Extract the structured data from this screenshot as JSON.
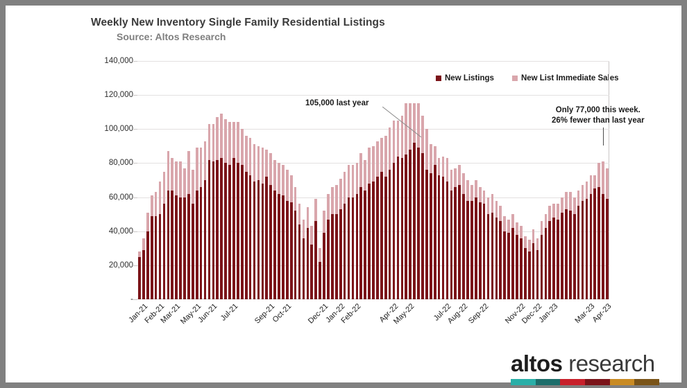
{
  "header": {
    "title": "Weekly New Inventory Single Family Residential Listings",
    "subtitle": "Source: Altos Research"
  },
  "legend": {
    "items": [
      {
        "label": "New Listings",
        "color": "#7B1419"
      },
      {
        "label": "New List Immediate Sales",
        "color": "#D9A6AC"
      }
    ]
  },
  "annotations": {
    "left": "105,000 last year",
    "right_line1": "Only 77,000 this week.",
    "right_line2": "26% fewer than last year"
  },
  "logo": {
    "primary": "altos",
    "secondary": "research",
    "bar_colors": [
      "#2AAFA8",
      "#1D6E6B",
      "#C8202B",
      "#7B1419",
      "#C98B24",
      "#7A5418"
    ]
  },
  "chart_data": {
    "type": "bar",
    "stacked": true,
    "title": "Weekly New Inventory Single Family Residential Listings",
    "subtitle": "Source: Altos Research",
    "xlabel": "",
    "ylabel": "",
    "ylim": [
      0,
      140000
    ],
    "ytick_values": [
      0,
      20000,
      40000,
      60000,
      80000,
      100000,
      120000,
      140000
    ],
    "ytick_labels": [
      "-",
      "20,000",
      "40,000",
      "60,000",
      "80,000",
      "100,000",
      "120,000",
      "140,000"
    ],
    "grid": true,
    "legend_position": "top-right",
    "xtick_labels": [
      "Jan-21",
      "Feb-21",
      "Mar-21",
      "May-21",
      "Jun-21",
      "Jul-21",
      "Sep-21",
      "Oct-21",
      "Dec-21",
      "Jan-22",
      "Feb-22",
      "Apr-22",
      "May-22",
      "Jul-22",
      "Aug-22",
      "Sep-22",
      "Nov-22",
      "Dec-22",
      "Jan-23",
      "Mar-23",
      "Apr-23"
    ],
    "xtick_indices": [
      1,
      5,
      9,
      14,
      18,
      23,
      32,
      36,
      45,
      49,
      53,
      62,
      66,
      75,
      79,
      84,
      93,
      97,
      101,
      110,
      114
    ],
    "series": [
      {
        "name": "New Listings",
        "color": "#7B1419",
        "values": [
          25000,
          29000,
          40000,
          49000,
          49000,
          50000,
          56000,
          64000,
          64000,
          61000,
          60000,
          60000,
          62000,
          56000,
          64000,
          66000,
          70000,
          82000,
          81000,
          82000,
          83000,
          80000,
          79000,
          83000,
          80000,
          79000,
          75000,
          73000,
          69000,
          70000,
          68000,
          72000,
          67000,
          64000,
          62000,
          61000,
          58000,
          57000,
          52000,
          44000,
          36000,
          42000,
          32000,
          46000,
          22000,
          39000,
          47000,
          50000,
          50000,
          53000,
          56000,
          60000,
          60000,
          62000,
          66000,
          64000,
          68000,
          69000,
          72000,
          75000,
          72000,
          76000,
          80000,
          84000,
          83000,
          85000,
          88000,
          92000,
          89000,
          86000,
          76000,
          74000,
          79000,
          73000,
          72000,
          69000,
          64000,
          66000,
          67000,
          62000,
          58000,
          58000,
          60000,
          57000,
          56000,
          50000,
          51000,
          48000,
          46000,
          40000,
          39000,
          42000,
          38000,
          36000,
          30000,
          28000,
          33000,
          29000,
          38000,
          42000,
          46000,
          48000,
          47000,
          51000,
          53000,
          52000,
          50000,
          55000,
          58000,
          59000,
          62000,
          65000,
          66000,
          62000,
          59000
        ]
      },
      {
        "name": "New List Immediate Sales",
        "color": "#D9A6AC",
        "values": [
          3000,
          7000,
          11000,
          12000,
          14000,
          19000,
          19000,
          23000,
          19000,
          20000,
          21000,
          17000,
          25000,
          20000,
          25000,
          23000,
          23000,
          21000,
          22000,
          25000,
          26000,
          26000,
          25000,
          21000,
          24000,
          21000,
          21000,
          22000,
          22000,
          20000,
          21000,
          16000,
          19000,
          18000,
          18000,
          18000,
          18000,
          16000,
          14000,
          12000,
          11000,
          12000,
          11000,
          13000,
          8000,
          13000,
          15000,
          16000,
          17000,
          18000,
          19000,
          19000,
          19000,
          18000,
          20000,
          18000,
          21000,
          21000,
          21000,
          20000,
          24000,
          25000,
          25000,
          21000,
          25000,
          30000,
          27000,
          23000,
          26000,
          22000,
          24000,
          17000,
          11000,
          10000,
          12000,
          14000,
          12000,
          11000,
          12000,
          12000,
          12000,
          9000,
          10000,
          9000,
          8000,
          10000,
          11000,
          10000,
          9000,
          9000,
          8000,
          8000,
          7000,
          7000,
          7000,
          7000,
          8000,
          7000,
          8000,
          8000,
          9000,
          8000,
          9000,
          9000,
          10000,
          11000,
          10000,
          9000,
          9000,
          10000,
          11000,
          8000,
          14000,
          19000,
          18000
        ]
      }
    ]
  }
}
